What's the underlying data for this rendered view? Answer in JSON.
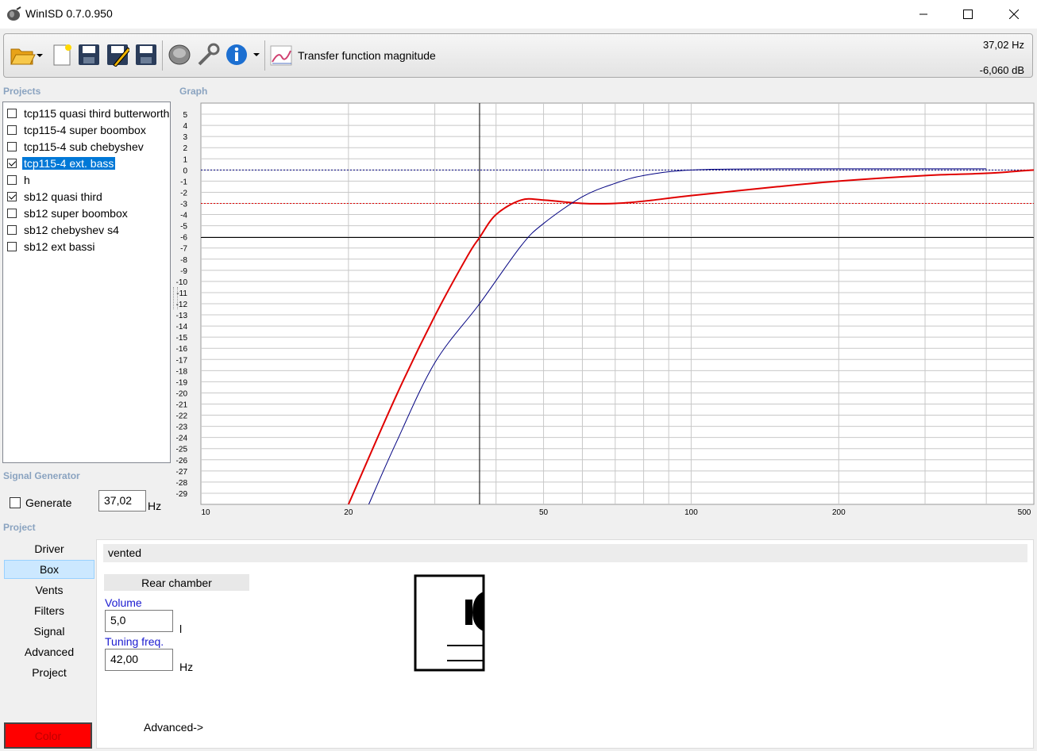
{
  "window": {
    "title": "WinISD 0.7.0.950"
  },
  "toolbar": {
    "view_label": "Transfer function magnitude",
    "cursor_freq": "37,02 Hz",
    "cursor_level": "-6,060 dB"
  },
  "sections": {
    "projects": "Projects",
    "graph": "Graph",
    "signal_generator": "Signal Generator",
    "project": "Project"
  },
  "projects": [
    {
      "name": "tcp115 quasi third butterworth",
      "checked": false,
      "selected": false
    },
    {
      "name": "tcp115-4 super boombox",
      "checked": false,
      "selected": false
    },
    {
      "name": "tcp115-4 sub chebyshev",
      "checked": false,
      "selected": false
    },
    {
      "name": "tcp115-4 ext. bass",
      "checked": true,
      "selected": true
    },
    {
      "name": "h",
      "checked": false,
      "selected": false
    },
    {
      "name": "sb12 quasi third",
      "checked": true,
      "selected": false
    },
    {
      "name": "sb12 super boombox",
      "checked": false,
      "selected": false
    },
    {
      "name": "sb12 chebyshev s4",
      "checked": false,
      "selected": false
    },
    {
      "name": "sb12 ext bassi",
      "checked": false,
      "selected": false
    }
  ],
  "signal_generator": {
    "generate_label": "Generate",
    "frequency": "37,02",
    "unit": "Hz"
  },
  "nav": [
    "Driver",
    "Box",
    "Vents",
    "Filters",
    "Signal",
    "Advanced",
    "Project"
  ],
  "nav_active": "Box",
  "box": {
    "type": "vented",
    "chamber_label": "Rear chamber",
    "volume_label": "Volume",
    "volume_value": "5,0",
    "volume_unit": "l",
    "tuning_label": "Tuning freq.",
    "tuning_value": "42,00",
    "tuning_unit": "Hz",
    "advanced_label": "Advanced->"
  },
  "color_button": "Color",
  "colors": {
    "series_red": "#e00000",
    "series_blue": "#000080",
    "selection": "#0078d7"
  },
  "chart_data": {
    "type": "line",
    "xscale": "log",
    "xlim": [
      10,
      500
    ],
    "ylim": [
      -30,
      6
    ],
    "x_ticks": [
      10,
      20,
      50,
      100,
      200,
      500
    ],
    "y_ticks": [
      5,
      4,
      3,
      2,
      1,
      0,
      -1,
      -2,
      -3,
      -4,
      -5,
      -6,
      -7,
      -8,
      -9,
      -10,
      -11,
      -12,
      -13,
      -14,
      -15,
      -16,
      -17,
      -18,
      -19,
      -20,
      -21,
      -22,
      -23,
      -24,
      -25,
      -26,
      -27,
      -28,
      -29
    ],
    "grid": true,
    "cursor": {
      "x": 37.02,
      "y": -6.06
    },
    "reference_lines": [
      {
        "y": 0,
        "color": "#000080"
      },
      {
        "y": -3,
        "color": "#e00000"
      }
    ],
    "series": [
      {
        "color": "#e00000",
        "x": [
          20,
          25,
          30,
          35,
          37.02,
          40,
          45,
          50,
          60,
          70,
          80,
          100,
          150,
          200,
          300,
          400,
          500
        ],
        "y": [
          -30,
          -20.3,
          -13.1,
          -7.7,
          -6.06,
          -4.0,
          -2.7,
          -2.7,
          -3.0,
          -3.0,
          -2.8,
          -2.3,
          -1.5,
          -1.0,
          -0.5,
          -0.3,
          0
        ]
      },
      {
        "color": "#000080",
        "x": [
          22,
          25,
          30,
          37.02,
          45,
          50,
          60,
          70,
          80,
          100,
          150,
          200,
          300,
          400
        ],
        "y": [
          -30,
          -24.5,
          -17.3,
          -12.0,
          -6.8,
          -4.8,
          -2.4,
          -1.2,
          -0.5,
          0,
          0.1,
          0.1,
          0.1,
          0.1
        ]
      }
    ]
  }
}
